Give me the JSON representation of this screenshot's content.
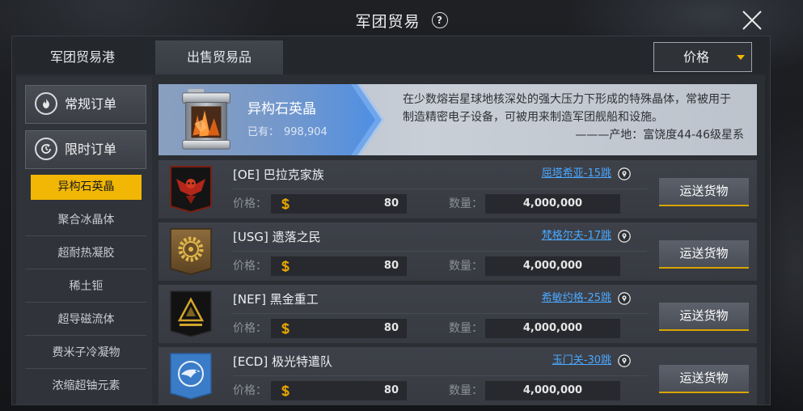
{
  "window": {
    "title": "军团贸易",
    "help_glyph": "?",
    "help_icon": "help-circle-icon",
    "close_icon": "close-icon"
  },
  "tabs": [
    {
      "label": "军团贸易港",
      "selected": false
    },
    {
      "label": "出售贸易品",
      "selected": true
    }
  ],
  "sort_dropdown": {
    "value": "价格",
    "icon": "caret-down-icon"
  },
  "sidebar": {
    "categories": [
      {
        "label": "常规订单",
        "icon": "flame-icon"
      },
      {
        "label": "限时订单",
        "icon": "clock-icon"
      }
    ],
    "items": [
      {
        "label": "异构石英晶",
        "selected": true
      },
      {
        "label": "聚合冰晶体",
        "selected": false
      },
      {
        "label": "超耐热凝胶",
        "selected": false
      },
      {
        "label": "稀土钷",
        "selected": false
      },
      {
        "label": "超导磁流体",
        "selected": false
      },
      {
        "label": "费米子冷凝物",
        "selected": false
      },
      {
        "label": "浓缩超铀元素",
        "selected": false
      }
    ]
  },
  "item_detail": {
    "name": "异构石英晶",
    "icon": "ore-canister-icon",
    "owned_label": "已有：",
    "owned_value": "998,904",
    "description": [
      "在少数熔岩星球地核深处的强大压力下形成的特殊晶体，常被用于",
      "制造精密电子设备，可被用来制造军团舰船和设施。"
    ],
    "origin": "———产地：富饶度44-46级星系"
  },
  "currency_icon": "gold-coin-icon",
  "location_icon": "location-pin-icon",
  "orders": [
    {
      "corp": "[OE] 巴拉克家族",
      "emblem": "red-eagle-emblem",
      "location": "屈塔希亚-15跳",
      "price_label": "价格：",
      "price": "80",
      "quantity_label": "数量：",
      "quantity": "4,000,000",
      "action_label": "运送货物"
    },
    {
      "corp": "[USG] 遗落之民",
      "emblem": "gold-gear-emblem",
      "location": "梵格尔夫-17跳",
      "price_label": "价格：",
      "price": "80",
      "quantity_label": "数量：",
      "quantity": "4,000,000",
      "action_label": "运送货物"
    },
    {
      "corp": "[NEF] 黑金重工",
      "emblem": "gold-triangle-emblem",
      "location": "希敏约格-25跳",
      "price_label": "价格：",
      "price": "80",
      "quantity_label": "数量：",
      "quantity": "4,000,000",
      "action_label": "运送货物"
    },
    {
      "corp": "[ECD] 极光特遣队",
      "emblem": "blue-aurora-emblem",
      "location": "玉门关-30跳",
      "price_label": "价格：",
      "price": "80",
      "quantity_label": "数量：",
      "quantity": "4,000,000",
      "action_label": "运送货物"
    }
  ],
  "colors": {
    "accent_yellow": "#f2b705",
    "link_blue": "#4aa8ff",
    "button_underline": "#d9a400",
    "currency_gold": "#e3a400",
    "detail_blue": "#468ce6"
  }
}
